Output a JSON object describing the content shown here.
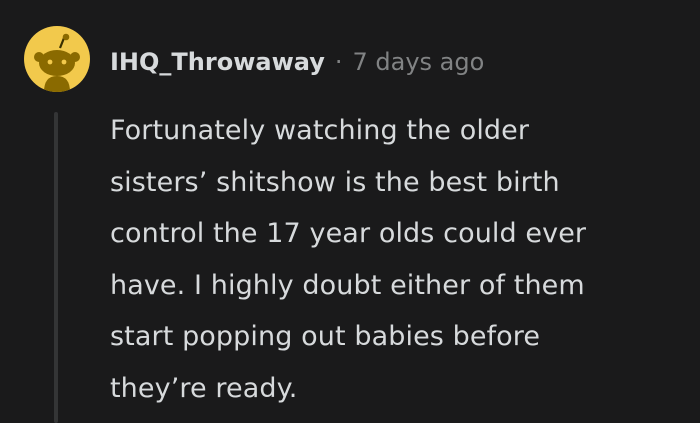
{
  "comment": {
    "username": "IHQ_Throwaway",
    "separator": "·",
    "timestamp": "7 days ago",
    "body_lines": [
      "Fortunately watching the older",
      "sisters’ shitshow is the best birth",
      "control the 17 year olds could ever",
      "have. I highly doubt either of them",
      "start popping out babies before",
      "they’re ready."
    ]
  },
  "colors": {
    "background": "#1a1a1b",
    "avatar_bg": "#f2c94c",
    "text_primary": "#d7dadc",
    "text_meta": "#818384",
    "thread_line": "#343536"
  },
  "icons": {
    "avatar": "snoo-avatar-icon"
  }
}
